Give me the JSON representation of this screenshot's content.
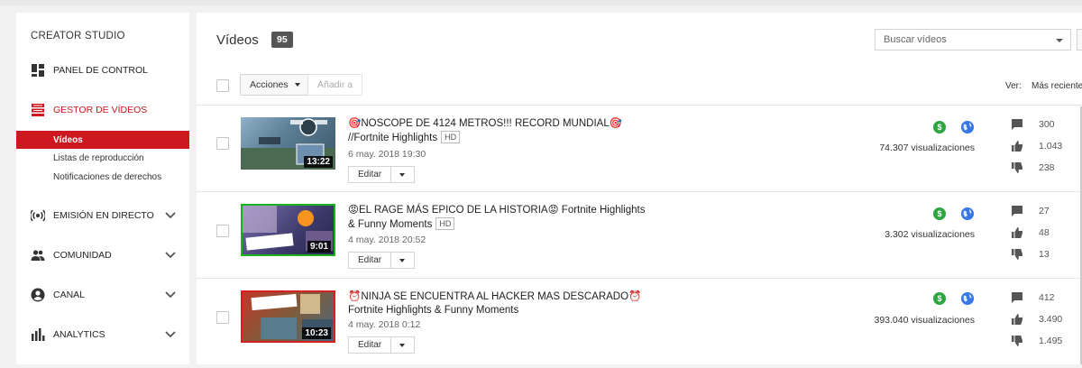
{
  "sidebar": {
    "title": "CREATOR STUDIO",
    "items": [
      {
        "label": "PANEL DE CONTROL",
        "icon": "dashboard-icon"
      },
      {
        "label": "GESTOR DE VÍDEOS",
        "icon": "video-manager-icon"
      },
      {
        "label": "EMISIÓN EN DIRECTO",
        "icon": "live-icon"
      },
      {
        "label": "COMUNIDAD",
        "icon": "community-icon"
      },
      {
        "label": "CANAL",
        "icon": "channel-icon"
      },
      {
        "label": "ANALYTICS",
        "icon": "analytics-icon"
      }
    ],
    "subitems": [
      "Vídeos",
      "Listas de reproducción",
      "Notificaciones de derechos"
    ],
    "accent": "#cc181e"
  },
  "main": {
    "title": "Vídeos",
    "count": "95",
    "search_placeholder": "Buscar vídeos",
    "actions_label": "Acciones",
    "add_to_label": "Añadir a",
    "view_label": "Ver:",
    "sort_label": "Más reciente",
    "edit_label": "Editar"
  },
  "videos": [
    {
      "title_line1": "🎯NOSCOPE DE 4124 METROS!!! RECORD MUNDIAL🎯",
      "title_line2": "//Fortnite Highlights",
      "hd": "HD",
      "date": "6 may. 2018 19:30",
      "duration": "13:22",
      "views": "74.307 visualizaciones",
      "comments": "300",
      "likes": "1.043",
      "dislikes": "238"
    },
    {
      "title_line1": "😡EL RAGE MÁS EPICO DE LA HISTORIA😡 Fortnite Highlights",
      "title_line2": "& Funny Moments",
      "hd": "HD",
      "date": "4 may. 2018 20:52",
      "duration": "9:01",
      "views": "3.302 visualizaciones",
      "comments": "27",
      "likes": "48",
      "dislikes": "13"
    },
    {
      "title_line1": "⏰NINJA SE ENCUENTRA AL HACKER MAS DESCARADO⏰",
      "title_line2": "Fortnite Highlights & Funny Moments",
      "hd": "",
      "date": "4 may. 2018 0:12",
      "duration": "10:23",
      "views": "393.040 visualizaciones",
      "comments": "412",
      "likes": "3.490",
      "dislikes": "1.495"
    }
  ]
}
